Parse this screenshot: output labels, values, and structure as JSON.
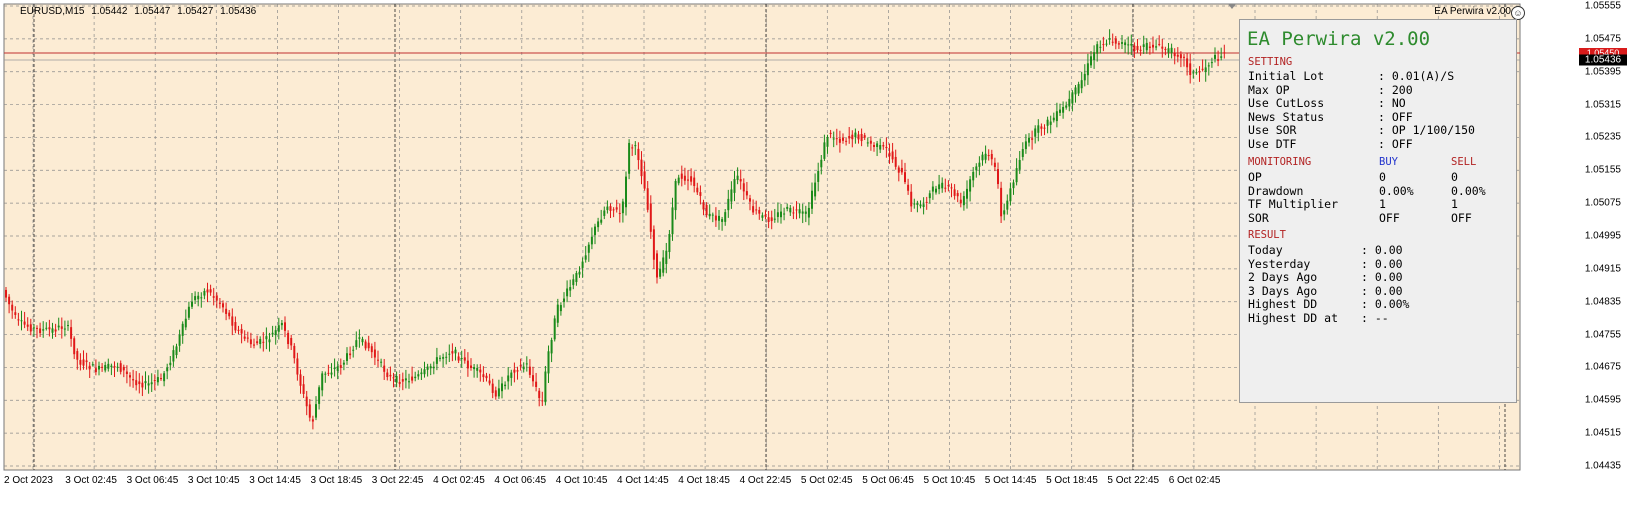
{
  "chart": {
    "symbol_info": [
      "EURUSD,M15",
      "1.05442",
      "1.05447",
      "1.05427",
      "1.05436"
    ],
    "ea_tag": "EA Perwira v2.00",
    "ea_tag_icon": "☺",
    "price_axis": [
      "1.05555",
      "1.05475",
      "1.05395",
      "1.05315",
      "1.05235",
      "1.05155",
      "1.05075",
      "1.04995",
      "1.04915",
      "1.04835",
      "1.04755",
      "1.04675",
      "1.04595",
      "1.04515",
      "1.04435"
    ],
    "current_price": "1.05436",
    "red_tag": "1.05450",
    "time_axis": [
      "2 Oct 2023",
      "3 Oct 02:45",
      "3 Oct 06:45",
      "3 Oct 10:45",
      "3 Oct 14:45",
      "3 Oct 18:45",
      "3 Oct 22:45",
      "4 Oct 02:45",
      "4 Oct 06:45",
      "4 Oct 10:45",
      "4 Oct 14:45",
      "4 Oct 18:45",
      "4 Oct 22:45",
      "5 Oct 02:45",
      "5 Oct 06:45",
      "5 Oct 10:45",
      "5 Oct 14:45",
      "5 Oct 18:45",
      "5 Oct 22:45",
      "6 Oct 02:45"
    ],
    "colors": {
      "background": "#fcecd4",
      "bull": "#1a8a1a",
      "bear": "#e01818",
      "grid": "#8a8a8a",
      "line": "#c03030"
    }
  },
  "panel": {
    "title": "EA Perwira v2.00",
    "setting": {
      "header": "SETTING",
      "rows": [
        {
          "label": "Initial Lot",
          "value": ": 0.01(A)/S"
        },
        {
          "label": "Max OP",
          "value": ": 200"
        },
        {
          "label": "Use CutLoss",
          "value": ": NO"
        },
        {
          "label": "News Status",
          "value": ": OFF"
        },
        {
          "label": "Use SOR",
          "value": ": OP 1/100/150"
        },
        {
          "label": "Use DTF",
          "value": ": OFF"
        }
      ]
    },
    "monitoring": {
      "header": "MONITORING",
      "buy_label": "BUY",
      "sell_label": "SELL",
      "rows": [
        {
          "label": "OP",
          "buy": "0",
          "sell": "0"
        },
        {
          "label": "Drawdown",
          "buy": "0.00%",
          "sell": "0.00%"
        },
        {
          "label": "TF Multiplier",
          "buy": "1",
          "sell": "1"
        },
        {
          "label": "SOR",
          "buy": "OFF",
          "sell": "OFF"
        }
      ]
    },
    "result": {
      "header": "RESULT",
      "rows": [
        {
          "label": "Today",
          "value": ": 0.00"
        },
        {
          "label": "Yesterday",
          "value": ": 0.00"
        },
        {
          "label": "2 Days Ago",
          "value": ": 0.00"
        },
        {
          "label": "3 Days Ago",
          "value": ": 0.00"
        },
        {
          "label": "Highest DD",
          "value": ": 0.00%"
        },
        {
          "label": "Highest DD at",
          "value": ": --"
        }
      ]
    }
  }
}
